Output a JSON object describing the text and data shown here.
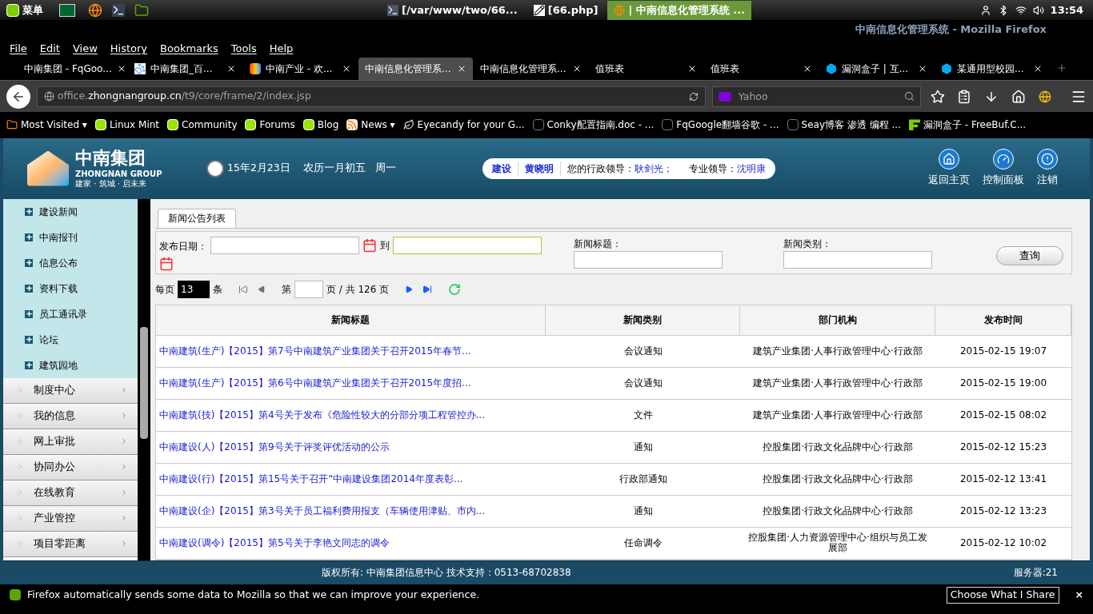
{
  "taskbar": {
    "menu_label": "菜单",
    "windows": [
      {
        "title": "[/var/www/two/66...",
        "kind": "terminal",
        "selected": false
      },
      {
        "title": "[66.php]",
        "kind": "editor",
        "selected": false
      },
      {
        "title": "| 中南信息化管理系统 ...",
        "kind": "firefox",
        "selected": true
      }
    ],
    "clock": "13:54"
  },
  "window": {
    "title": "中南信息化管理系统 - Mozilla Firefox"
  },
  "menu": [
    "File",
    "Edit",
    "View",
    "History",
    "Bookmarks",
    "Tools",
    "Help"
  ],
  "tabs": [
    {
      "label": "中南集团 - FqGoo...",
      "kind": "page",
      "selected": false
    },
    {
      "label": "中南集团_百...",
      "kind": "paw",
      "selected": false
    },
    {
      "label": "中南产业 - 欢...",
      "kind": "logo",
      "selected": false
    },
    {
      "label": "中南信息化管理系...",
      "kind": "none",
      "selected": true
    },
    {
      "label": "中南信息化管理系...",
      "kind": "none",
      "selected": false
    },
    {
      "label": "值班表",
      "kind": "none",
      "selected": false
    },
    {
      "label": "值班表",
      "kind": "none",
      "selected": false
    },
    {
      "label": "漏洞盒子 | 互...",
      "kind": "hex",
      "selected": false
    },
    {
      "label": "某通用型校园...",
      "kind": "hex",
      "selected": false
    }
  ],
  "url": {
    "host_prefix": "office.",
    "host": "zhongnangroup.cn",
    "path": "/t9/core/frame/2/index.jsp"
  },
  "search": {
    "placeholder": "Yahoo"
  },
  "bookmarks": [
    {
      "label": "Most Visited ▾",
      "kind": "folder"
    },
    {
      "label": "Linux Mint",
      "kind": "mint"
    },
    {
      "label": "Community",
      "kind": "mint"
    },
    {
      "label": "Forums",
      "kind": "mint"
    },
    {
      "label": "Blog",
      "kind": "mint"
    },
    {
      "label": "News ▾",
      "kind": "rss"
    },
    {
      "label": "Eyecandy for your G...",
      "kind": "leaf"
    },
    {
      "label": "Conky配置指南.doc - ...",
      "kind": "page"
    },
    {
      "label": "FqGoogle翻墙谷歌 - ...",
      "kind": "page"
    },
    {
      "label": "Seay博客 渗透 编程 ...",
      "kind": "page"
    },
    {
      "label": "漏洞盒子 - FreeBuf.C...",
      "kind": "f"
    }
  ],
  "header": {
    "logo_cn": "中南集团",
    "logo_en": "ZHONGNAN GROUP",
    "slogan": "建家 · 筑城 · 启未来",
    "date": "15年2月23日",
    "lunar": "农历一月初五",
    "weekday": "周一",
    "crumb": [
      "建设",
      "黄晓明"
    ],
    "admin_label": "您的行政领导：",
    "admin_name": "耿剑光；",
    "pro_label": "专业领导：",
    "pro_name": "沈明康",
    "actions": [
      {
        "label": "返回主页",
        "kind": "home"
      },
      {
        "label": "控制面板",
        "kind": "panel"
      },
      {
        "label": "注销",
        "kind": "logout"
      }
    ]
  },
  "sidebar": {
    "sub_items": [
      "建设新闻",
      "中南报刊",
      "信息公布",
      "资料下载",
      "员工通讯录",
      "论坛",
      "建筑园地"
    ],
    "items": [
      "制度中心",
      "我的信息",
      "网上审批",
      "协同办公",
      "在线教育",
      "产业管控",
      "项目零距离"
    ]
  },
  "content_tab": {
    "label": "新闻公告列表",
    "selected": true
  },
  "filter": {
    "date_label": "发布日期：",
    "to_label": "到",
    "date_to": {
      "focused": true
    },
    "title_label": "新闻标题：",
    "type_label": "新闻类别：",
    "query_button": "查询"
  },
  "pager": {
    "per_page_label": "每页",
    "per_page": "13",
    "per_page_unit": "条",
    "page_label": "第",
    "total": "页 / 共 126 页"
  },
  "table": {
    "columns": [
      "新闻标题",
      "新闻类别",
      "部门机构",
      "发布时间"
    ],
    "rows": [
      [
        "中南建筑(生产)【2015】第7号中南建筑产业集团关于召开2015年春节...",
        "会议通知",
        "建筑产业集团·人事行政管理中心·行政部",
        "2015-02-15 19:07"
      ],
      [
        "中南建筑(生产)【2015】第6号中南建筑产业集团关于召开2015年度招...",
        "会议通知",
        "建筑产业集团·人事行政管理中心·行政部",
        "2015-02-15 19:00"
      ],
      [
        "中南建筑(技)【2015】第4号关于发布《危险性较大的分部分项工程管控办...",
        "文件",
        "建筑产业集团·人事行政管理中心·行政部",
        "2015-02-15 08:02"
      ],
      [
        "中南建设(人)【2015】第9号关于评奖评优活动的公示",
        "通知",
        "控股集团·行政文化品牌中心·行政部",
        "2015-02-12 15:23"
      ],
      [
        "中南建设(行)【2015】第15号关于召开“中南建设集团2014年度表彰...",
        "行政部通知",
        "控股集团·行政文化品牌中心·行政部",
        "2015-02-12 13:41"
      ],
      [
        "中南建设(企)【2015】第3号关于员工福利费用报支（车辆使用津贴、市内...",
        "通知",
        "控股集团·行政文化品牌中心·行政部",
        "2015-02-12 13:23"
      ],
      [
        "中南建设(调令)【2015】第5号关于李艳文同志的调令",
        "任命调令",
        "控股集团·人力资源管理中心·组织与员工发展部",
        "2015-02-12 10:02"
      ]
    ]
  },
  "footer": {
    "copyright": "版权所有: 中南集团信息中心 技术支持：0513-68702838",
    "server": "服务器:21"
  },
  "notification": {
    "text": "Firefox automatically sends some data to Mozilla so that we can improve your experience.",
    "button": "Choose What I Share",
    "close": "×"
  }
}
